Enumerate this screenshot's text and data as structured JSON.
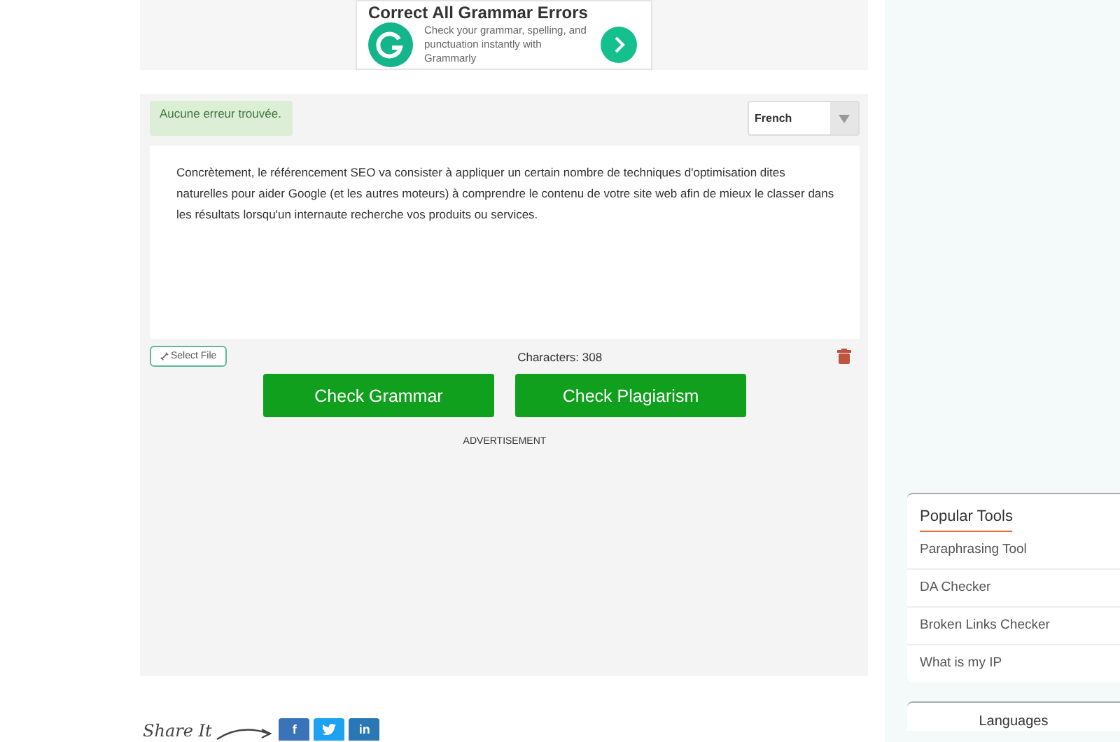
{
  "ad": {
    "headline": "Correct All Grammar Errors",
    "body": "Check your grammar, spelling, and punctuation instantly with Grammarly"
  },
  "checker": {
    "status": "Aucune erreur trouvée.",
    "language": "French",
    "text": "Concrètement, le référencement SEO va consister à appliquer un certain nombre de techniques d'optimisation dites naturelles pour aider Google (et les autres moteurs) à comprendre le contenu de votre site web afin de mieux le classer dans les résultats lorsqu'un internaute recherche vos produits ou services.",
    "select_file": "Select File",
    "characters": "Characters: 308",
    "buttons": [
      "Check Grammar",
      "Check Plagiarism"
    ],
    "ad_label": "ADVERTISEMENT"
  },
  "share": {
    "label": "Share It",
    "networks": [
      {
        "kind": "facebook",
        "label": "f"
      },
      {
        "kind": "twitter"
      },
      {
        "kind": "linkedin",
        "label": "in"
      }
    ]
  },
  "popular_tools": {
    "title": "Popular Tools",
    "items": [
      "Paraphrasing Tool",
      "DA Checker",
      "Broken Links Checker",
      "What is my IP"
    ]
  },
  "languages": {
    "title": "Languages"
  }
}
